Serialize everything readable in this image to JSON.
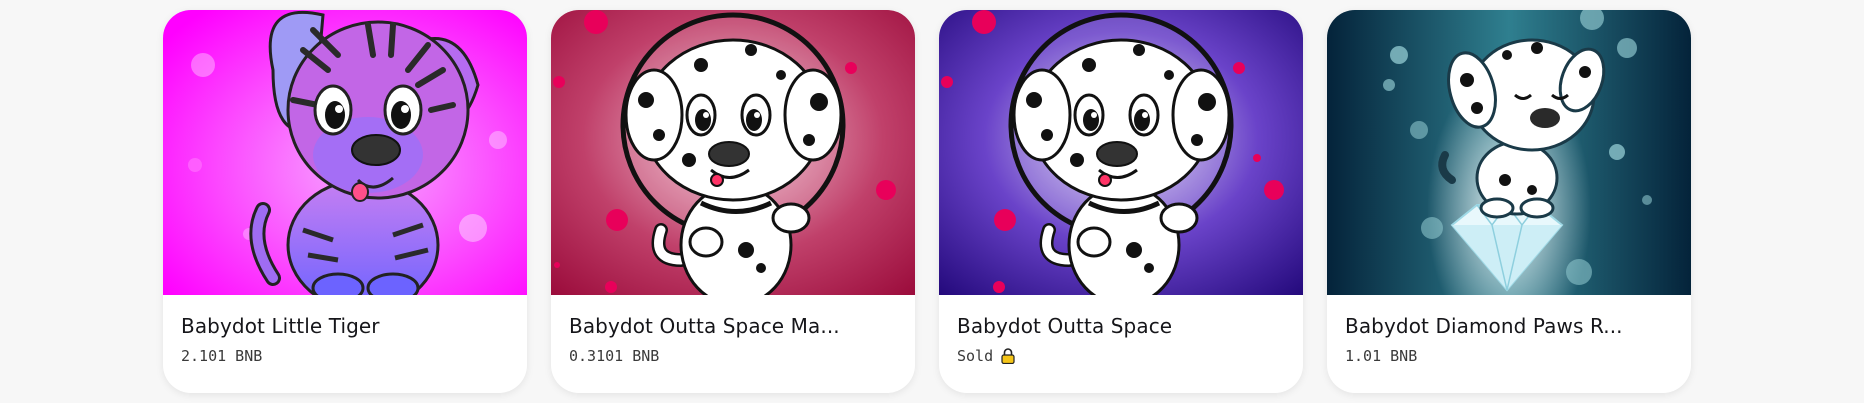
{
  "cards": [
    {
      "title": "Babydot Little Tiger",
      "price": "2.101 BNB",
      "icon": "tiger-puppy-art",
      "colors": {
        "bg_center": "#f7a8ff",
        "bg_edge": "#ff00ff",
        "body": "#b56bf0"
      }
    },
    {
      "title": "Babydot Outta Space Ma...",
      "price": "0.3101 BNB",
      "icon": "space-dalmatian-art",
      "colors": {
        "bg_center": "#f3c6d6",
        "bg_edge": "#9a0a3a",
        "dots": "#e8005a"
      }
    },
    {
      "title": "Babydot Outta Space",
      "price": "Sold",
      "sold": true,
      "icon": "space-dalmatian-art",
      "colors": {
        "bg_center": "#e7dff9",
        "bg_edge": "#22087a",
        "dots": "#e8005a"
      }
    },
    {
      "title": "Babydot Diamond Paws R...",
      "price": "1.01 BNB",
      "icon": "diamond-dalmatian-art",
      "colors": {
        "bg_center": "#d8f4f6",
        "bg_edge": "#05263a",
        "dots": "#7fb8c4"
      }
    }
  ],
  "sold_icon": "lock-icon",
  "sold_icon_color": "#f5c518"
}
